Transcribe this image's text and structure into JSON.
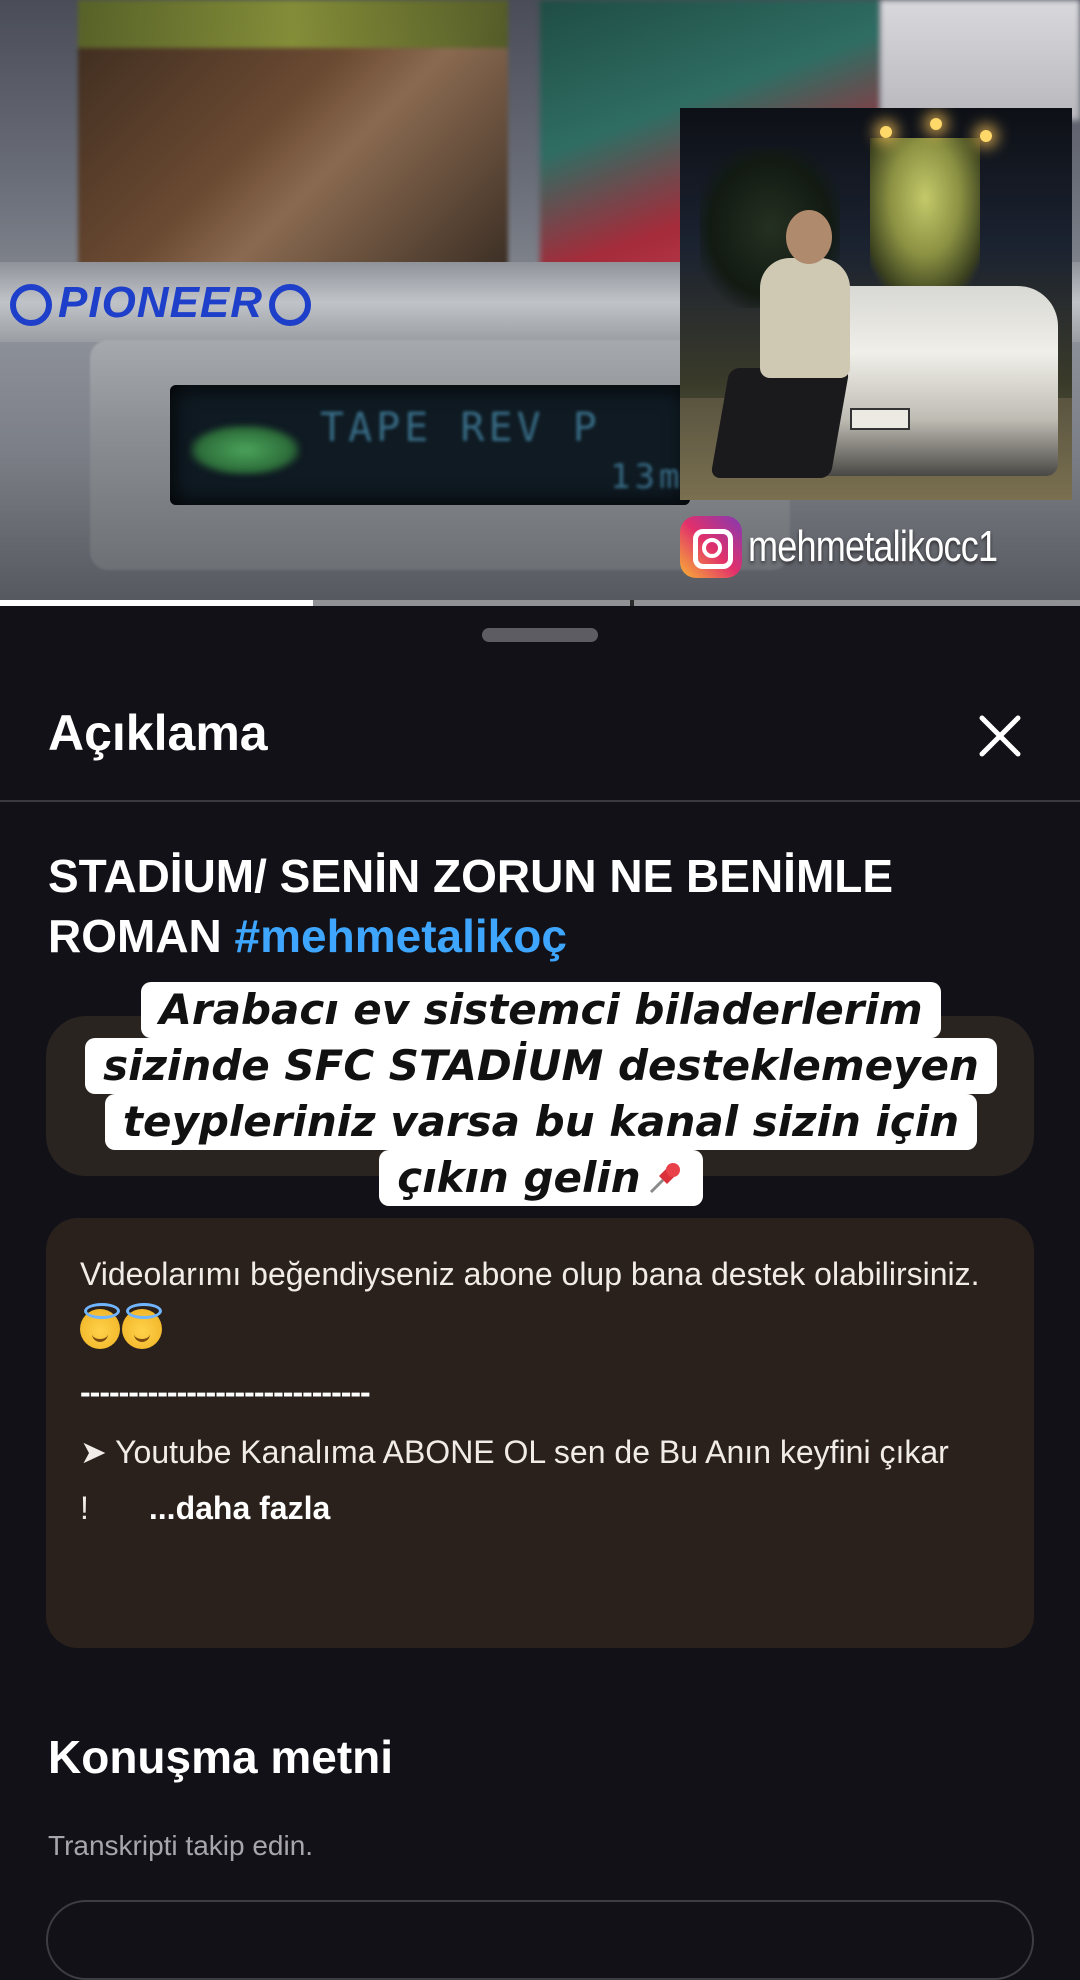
{
  "video": {
    "overlay_brand": "PIONEER",
    "lcd_readout": "TAPE      REV P",
    "lcd_digits": "13m",
    "instagram_handle": "mehmetalikocc1",
    "progress_fraction": 0.29
  },
  "sheet": {
    "title": "Açıklama",
    "close_icon": "close-icon",
    "video_title": "STADİUM/ SENİN ZORUN NE BENİMLE ROMAN",
    "hashtag": "#mehmetalikoç",
    "caption_lines": [
      "Arabacı ev sistemci biladerlerim",
      "sizinde SFC STADİUM desteklemeyen",
      "teypleriniz varsa bu kanal sizin için",
      "çıkın gelin"
    ],
    "description": {
      "para1": "Videolarımı beğendiyseniz abone olup bana destek olabilirsiniz.",
      "divider": "------------------------------",
      "para2": "➤ Youtube Kanalıma ABONE OL sen de Bu Anın keyfini çıkar !",
      "more_label": "...daha fazla"
    },
    "transcript": {
      "title": "Konuşma metni",
      "subtitle": "Transkripti takip edin."
    }
  },
  "colors": {
    "background": "#121117",
    "hashtag": "#3ea6ff",
    "desc_box": "#2a211c"
  }
}
